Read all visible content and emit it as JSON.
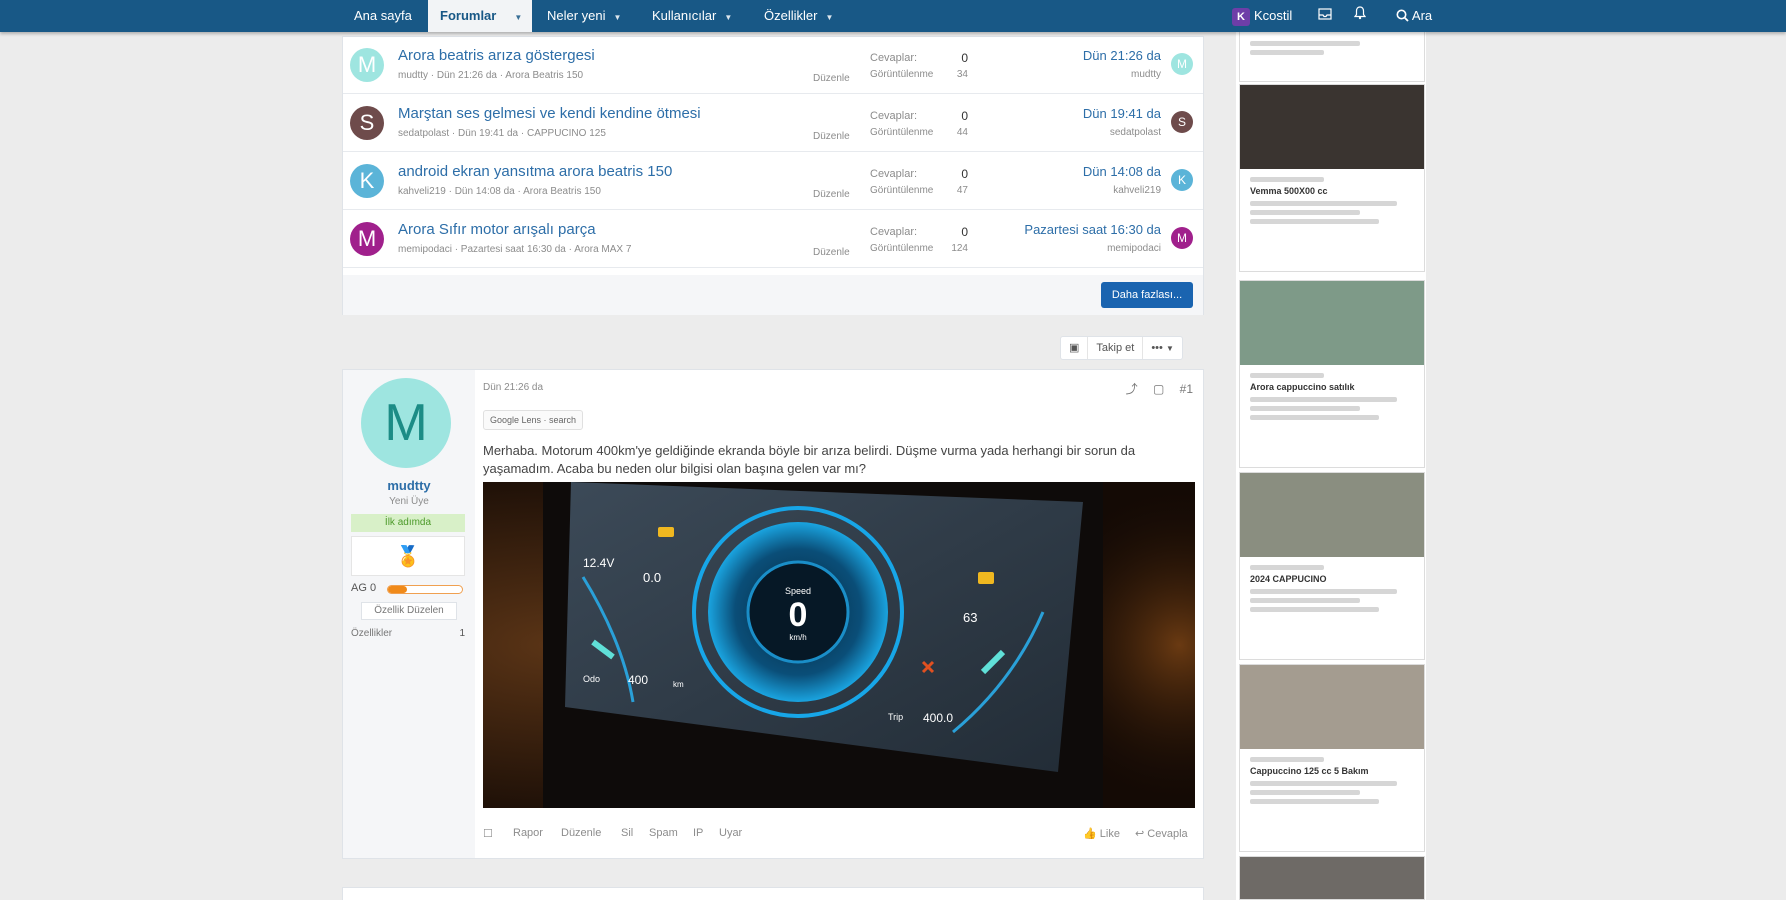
{
  "nav": {
    "items": [
      {
        "label": "Ana sayfa",
        "caret": false
      },
      {
        "label": "Forumlar",
        "caret": true,
        "active": true
      },
      {
        "label": "Neler yeni",
        "caret": true
      },
      {
        "label": "Kullanıcılar",
        "caret": true
      },
      {
        "label": "Özellikler",
        "caret": true
      }
    ],
    "user_initial": "K",
    "user_label": "Kcostil",
    "search_label": "Ara"
  },
  "threads": [
    {
      "avatar": "M",
      "avatar_color": "#9ee5e0",
      "title": "Arora beatris arıza göstergesi",
      "meta": "mudtty · Dün 21:26 da · Arora Beatris 150",
      "edit": "Düzenle",
      "replies_label": "Cevaplar:",
      "views_label": "Görüntülenme",
      "replies": "0",
      "views": "34",
      "last_date": "Dün 21:26 da",
      "last_user": "mudtty"
    },
    {
      "avatar": "S",
      "avatar_color": "#6e4b4b",
      "title": "Marştan ses gelmesi ve kendi kendine ötmesi",
      "meta": "sedatpolast · Dün 19:41 da · CAPPUCINO 125",
      "edit": "Düzenle",
      "replies_label": "Cevaplar:",
      "views_label": "Görüntülenme",
      "replies": "0",
      "views": "44",
      "last_date": "Dün 19:41 da",
      "last_user": "sedatpolast"
    },
    {
      "avatar": "K",
      "avatar_color": "#5bb4d8",
      "title": "android ekran yansıtma arora beatris 150",
      "meta": "kahveli219 · Dün 14:08 da · Arora Beatris 150",
      "edit": "Düzenle",
      "replies_label": "Cevaplar:",
      "views_label": "Görüntülenme",
      "replies": "0",
      "views": "47",
      "last_date": "Dün 14:08 da",
      "last_user": "kahveli219"
    },
    {
      "avatar": "M",
      "avatar_color": "#a0208c",
      "title": "Arora Sıfır motor arışalı parça",
      "meta": "memipodaci · Pazartesi saat 16:30 da · Arora MAX 7",
      "edit": "Düzenle",
      "replies_label": "Cevaplar:",
      "views_label": "Görüntülenme",
      "replies": "0",
      "views": "124",
      "last_date": "Pazartesi saat 16:30 da",
      "last_user": "memipodaci"
    }
  ],
  "more_button": "Daha fazlası...",
  "watch_bar": {
    "icon": "▣",
    "follow_label": "Takip et",
    "more_label": "•••"
  },
  "post": {
    "avatar": "M",
    "username": "mudtty",
    "user_title": "Yeni Üye",
    "status": "İlk adımda",
    "badge": "🏅",
    "ag_label": "AG 0",
    "level_progress": 0.25,
    "edit_profile_label": "Özellik Düzelen",
    "stat_label": "Özellikler",
    "stat_value": "1",
    "date": "Dün 21:26 da",
    "google_chip": "Google Lens · search",
    "body": "Merhaba. Motorum 400km'ye geldiğinde ekranda böyle bir arıza belirdi. Düşme vurma yada herhangi bir sorun da yaşamadım. Acaba bu neden olur bilgisi olan başına gelen var mı?",
    "post_number": "#1",
    "dash": {
      "voltage": "12.4V",
      "top_left_value": "0.0",
      "speed": "0",
      "speed_unit": "km/h",
      "speed_label": "Speed",
      "temp": "63",
      "odo_label": "Odo",
      "odo_value": "400",
      "odo_unit": "km",
      "trip_label": "Trip",
      "trip_value": "400.0"
    },
    "actions": {
      "report": "Rapor",
      "edit": "Düzenle",
      "delete": "Sil",
      "spam": "Spam",
      "ip": "IP",
      "warn": "Uyar",
      "like": "Like",
      "reply": "Cevapla"
    }
  },
  "sidebar_ads": [
    {
      "title": "Vemma 500X00 cc"
    },
    {
      "title": "Arora cappuccino satılık"
    },
    {
      "title": "2024 CAPPUCINO"
    },
    {
      "title": "Cappuccino 125 cc 5 Bakım"
    }
  ],
  "colors": {
    "nav": "#185886",
    "link": "#2d6ea8",
    "button": "#1a64b0"
  }
}
